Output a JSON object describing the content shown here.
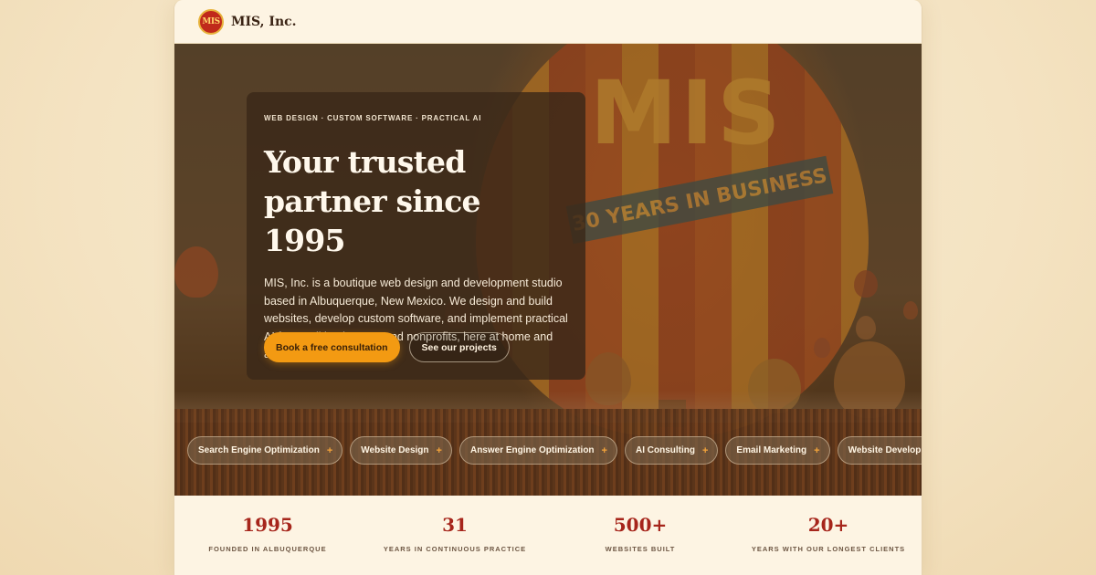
{
  "header": {
    "logo_text": "MIS",
    "brand_name": "MIS, Inc."
  },
  "hero": {
    "background_balloon_text": "MIS",
    "background_banner_text": "30 YEARS IN BUSINESS",
    "eyebrow": "WEB DESIGN · CUSTOM SOFTWARE · PRACTICAL AI",
    "headline": "Your trusted partner since 1995",
    "body": "MIS, Inc. is a boutique web design and development studio based in Albuquerque, New Mexico. We design and build websites, develop custom software, and implement practical AI for small businesses and nonprofits, here at home and around the world.",
    "primary_cta": "Book a free consultation",
    "secondary_cta": "See our projects"
  },
  "services": [
    {
      "label": "Search Engine Optimization",
      "icon": "plus-icon"
    },
    {
      "label": "Website Design",
      "icon": "plus-icon"
    },
    {
      "label": "Answer Engine Optimization",
      "icon": "plus-icon"
    },
    {
      "label": "AI Consulting",
      "icon": "plus-icon"
    },
    {
      "label": "Email Marketing",
      "icon": "plus-icon"
    },
    {
      "label": "Website Development",
      "icon": "plus-icon"
    }
  ],
  "plus_glyph": "+",
  "stats": [
    {
      "value": "1995",
      "label": "FOUNDED IN ALBUQUERQUE"
    },
    {
      "value": "31",
      "label": "YEARS IN CONTINUOUS PRACTICE"
    },
    {
      "value": "500+",
      "label": "WEBSITES BUILT"
    },
    {
      "value": "20+",
      "label": "YEARS WITH OUR LONGEST CLIENTS"
    }
  ],
  "colors": {
    "accent": "#f39a12",
    "brand_red": "#a6251b",
    "page_bg": "#fdf4e3"
  }
}
